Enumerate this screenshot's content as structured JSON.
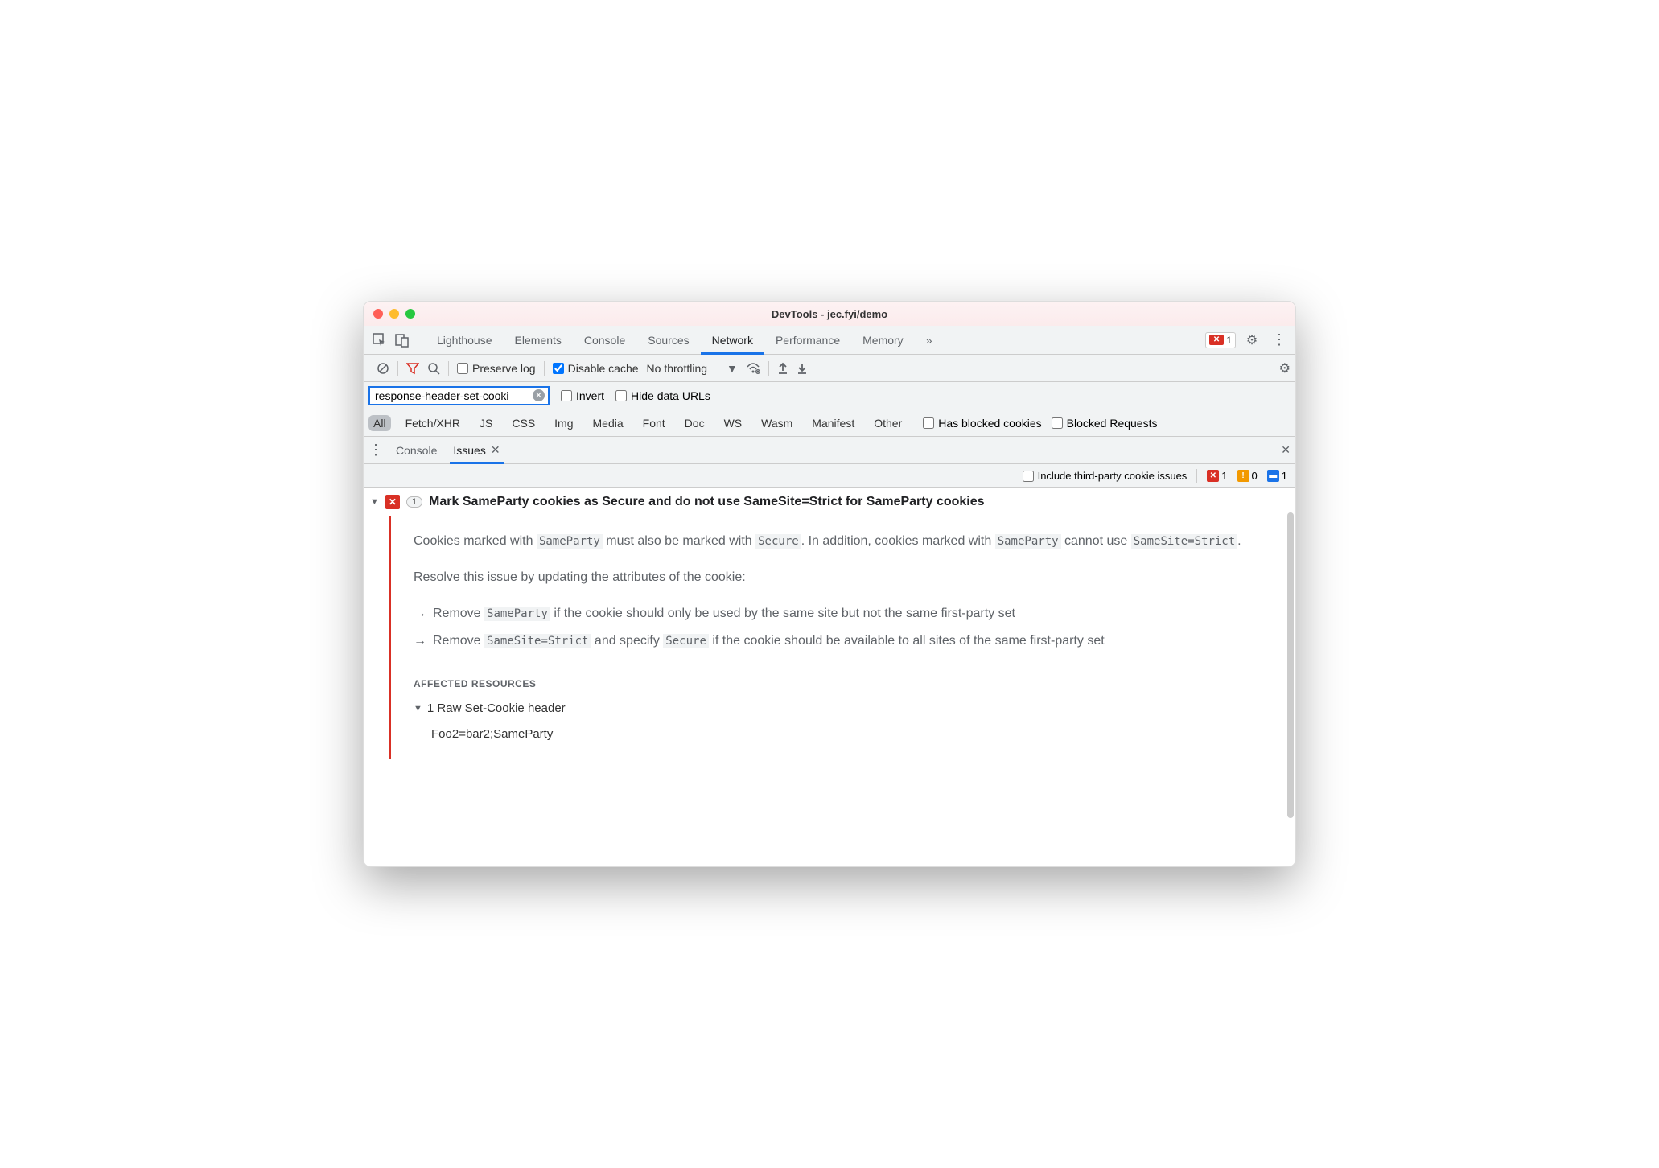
{
  "window": {
    "title": "DevTools - jec.fyi/demo"
  },
  "mainTabs": {
    "items": [
      "Lighthouse",
      "Elements",
      "Console",
      "Sources",
      "Network",
      "Performance",
      "Memory"
    ],
    "active": "Network"
  },
  "errorBadge": {
    "count": "1"
  },
  "networkToolbar": {
    "preserveLog": "Preserve log",
    "disableCache": "Disable cache",
    "disableCacheChecked": true,
    "throttling": "No throttling"
  },
  "filterRow": {
    "filterValue": "response-header-set-cooki",
    "invert": "Invert",
    "hideDataUrls": "Hide data URLs"
  },
  "typeRow": {
    "types": [
      "All",
      "Fetch/XHR",
      "JS",
      "CSS",
      "Img",
      "Media",
      "Font",
      "Doc",
      "WS",
      "Wasm",
      "Manifest",
      "Other"
    ],
    "blockedCookies": "Has blocked cookies",
    "blockedRequests": "Blocked Requests"
  },
  "drawer": {
    "tabs": [
      "Console",
      "Issues"
    ],
    "active": "Issues"
  },
  "issuesToolbar": {
    "thirdParty": "Include third-party cookie issues",
    "red": "1",
    "yellow": "0",
    "blue": "1"
  },
  "issue": {
    "count": "1",
    "title": "Mark SameParty cookies as Secure and do not use SameSite=Strict for SameParty cookies",
    "desc_p1a": "Cookies marked with ",
    "desc_p1_code1": "SameParty",
    "desc_p1b": " must also be marked with ",
    "desc_p1_code2": "Secure",
    "desc_p1c": ". In addition, cookies marked with ",
    "desc_p1_code3": "SameParty",
    "desc_p1d": " cannot use ",
    "desc_p1_code4": "SameSite=Strict",
    "desc_p1e": ".",
    "desc_p2": "Resolve this issue by updating the attributes of the cookie:",
    "bullet1a": "Remove ",
    "bullet1_code": "SameParty",
    "bullet1b": " if the cookie should only be used by the same site but not the same first-party set",
    "bullet2a": "Remove ",
    "bullet2_code1": "SameSite=Strict",
    "bullet2b": " and specify ",
    "bullet2_code2": "Secure",
    "bullet2c": " if the cookie should be available to all sites of the same first-party set",
    "affectedHeading": "AFFECTED RESOURCES",
    "resourceTitle": "1 Raw Set-Cookie header",
    "resourceValue": "Foo2=bar2;SameParty"
  }
}
